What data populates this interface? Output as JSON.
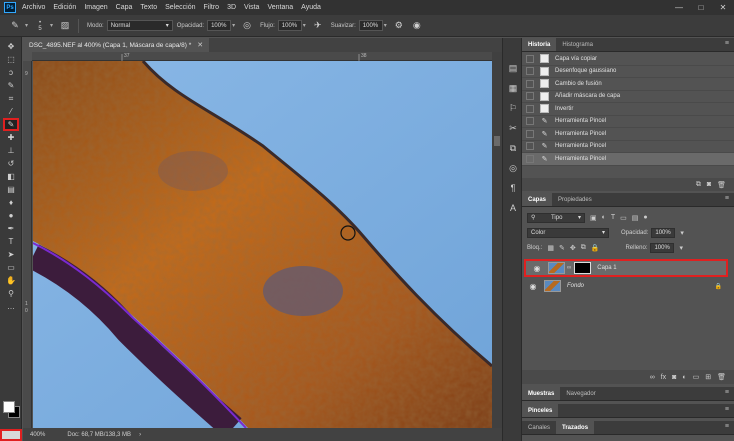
{
  "menubar": {
    "logo": "Ps",
    "items": [
      "Archivo",
      "Edición",
      "Imagen",
      "Capa",
      "Texto",
      "Selección",
      "Filtro",
      "3D",
      "Vista",
      "Ventana",
      "Ayuda"
    ],
    "window_controls": [
      "—",
      "□",
      "✕"
    ]
  },
  "options": {
    "brush_size": "5",
    "mode_label": "Modo:",
    "mode_value": "Normal",
    "opacity_label": "Opacidad:",
    "opacity_value": "100%",
    "flow_label": "Flujo:",
    "flow_value": "100%",
    "smoothing_label": "Suavizar:",
    "smoothing_value": "100%"
  },
  "tools": [
    {
      "name": "move-tool",
      "icon": "✥"
    },
    {
      "name": "marquee-tool",
      "icon": "⬚"
    },
    {
      "name": "lasso-tool",
      "icon": "ↄ"
    },
    {
      "name": "quick-selection-tool",
      "icon": "✎"
    },
    {
      "name": "crop-tool",
      "icon": "⌗"
    },
    {
      "name": "eyedropper-tool",
      "icon": "⁄"
    },
    {
      "name": "brush-tool",
      "icon": "✎",
      "active": true
    },
    {
      "name": "healing-tool",
      "icon": "✚"
    },
    {
      "name": "clone-stamp-tool",
      "icon": "⊥"
    },
    {
      "name": "history-brush-tool",
      "icon": "↺"
    },
    {
      "name": "eraser-tool",
      "icon": "◧"
    },
    {
      "name": "gradient-tool",
      "icon": "▤"
    },
    {
      "name": "blur-tool",
      "icon": "♦"
    },
    {
      "name": "dodge-tool",
      "icon": "●"
    },
    {
      "name": "pen-tool",
      "icon": "✒"
    },
    {
      "name": "type-tool",
      "icon": "T"
    },
    {
      "name": "path-selection-tool",
      "icon": "➤"
    },
    {
      "name": "shape-tool",
      "icon": "▭"
    },
    {
      "name": "hand-tool",
      "icon": "✋"
    },
    {
      "name": "zoom-tool",
      "icon": "⚲"
    },
    {
      "name": "more-tools",
      "icon": "…"
    }
  ],
  "document": {
    "tab_title": "DSC_4895.NEF al 400% (Capa 1, Máscara de capa/8) *",
    "ruler_h": [
      "37",
      "38"
    ],
    "ruler_v": [
      "9",
      "1",
      "0"
    ],
    "zoom": "400%",
    "doc_info": "Doc: 68,7 MB/138,3 MB"
  },
  "history": {
    "tabs": [
      "Historia",
      "Histograma"
    ],
    "items": [
      {
        "label": "Capa vía copiar",
        "icon": "doc"
      },
      {
        "label": "Desenfoque gaussiano",
        "icon": "doc"
      },
      {
        "label": "Cambio de fusión",
        "icon": "doc"
      },
      {
        "label": "Añadir máscara de capa",
        "icon": "doc"
      },
      {
        "label": "Invertir",
        "icon": "doc"
      },
      {
        "label": "Herramienta Pincel",
        "icon": "brush"
      },
      {
        "label": "Herramienta Pincel",
        "icon": "brush"
      },
      {
        "label": "Herramienta Pincel",
        "icon": "brush"
      },
      {
        "label": "Herramienta Pincel",
        "icon": "brush",
        "selected": true
      }
    ]
  },
  "layers": {
    "tabs": [
      "Capas",
      "Propiedades"
    ],
    "filter_kind": "Tipo",
    "blend_mode": "Color",
    "opacity_label": "Opacidad:",
    "opacity_value": "100%",
    "lock_label": "Bloq.:",
    "fill_label": "Relleno:",
    "fill_value": "100%",
    "items": [
      {
        "name": "Capa 1",
        "has_mask": true,
        "selected": true
      },
      {
        "name": "Fondo",
        "locked": true
      }
    ]
  },
  "stacked_panels": {
    "group1": [
      "Muestras",
      "Navegador"
    ],
    "group2": [
      "Pinceles"
    ],
    "group3": [
      "Canales",
      "Trazados"
    ]
  }
}
